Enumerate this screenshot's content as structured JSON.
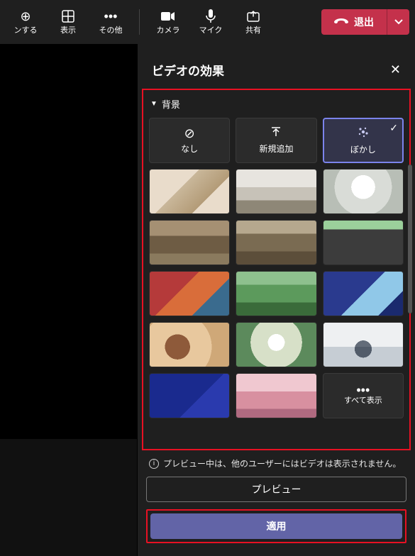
{
  "toolbar": {
    "items": [
      {
        "label": "ンする"
      },
      {
        "label": "表示"
      },
      {
        "label": "その他"
      },
      {
        "label": "カメラ"
      },
      {
        "label": "マイク"
      },
      {
        "label": "共有"
      }
    ],
    "leave_label": "退出"
  },
  "panel": {
    "title": "ビデオの効果",
    "section": "背景",
    "tiles": {
      "none": "なし",
      "add": "新規追加",
      "blur": "ぼかし",
      "show_all": "すべて表示"
    },
    "info": "プレビュー中は、他のユーザーにはビデオは表示されません。",
    "preview_btn": "プレビュー",
    "apply_btn": "適用"
  }
}
